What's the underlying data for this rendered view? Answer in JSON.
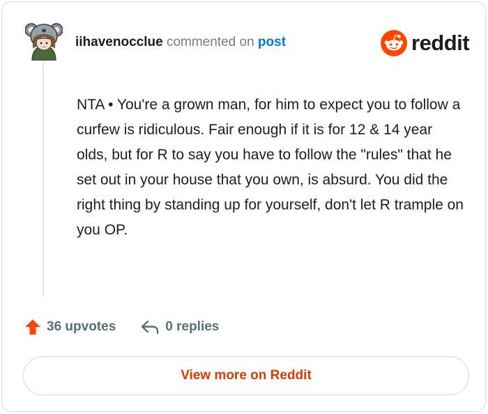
{
  "header": {
    "username": "iihavenocclue",
    "action_text": "commented on",
    "post_link": "post"
  },
  "brand": {
    "wordmark": "reddit",
    "logo_icon": "reddit-snoo-icon",
    "accent_color": "#ff4500"
  },
  "comment": {
    "body": "NTA • You're a grown man, for him to expect you to follow a curfew is ridiculous. Fair enough if it is for 12 & 14 year olds, but for R to say you have to follow the \"rules\" that he set out in your house that you own, is absurd. You did the right thing by standing up for yourself, don't let R trample on you OP."
  },
  "actions": {
    "upvotes": "36 upvotes",
    "replies": "0 replies",
    "upvote_icon": "upvote-arrow-icon",
    "reply_icon": "reply-arrow-icon"
  },
  "footer": {
    "view_more_label": "View more on Reddit",
    "view_more_color": "#d93a00"
  }
}
